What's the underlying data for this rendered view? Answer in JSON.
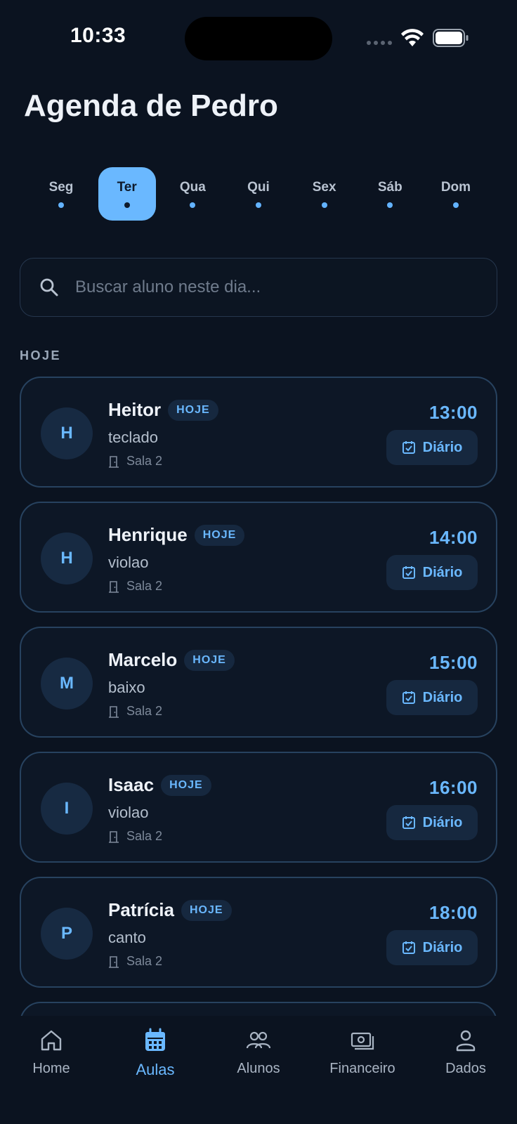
{
  "status_bar": {
    "time": "10:33"
  },
  "page": {
    "title": "Agenda de Pedro"
  },
  "days": [
    {
      "label": "Seg",
      "active": false
    },
    {
      "label": "Ter",
      "active": true
    },
    {
      "label": "Qua",
      "active": false
    },
    {
      "label": "Qui",
      "active": false
    },
    {
      "label": "Sex",
      "active": false
    },
    {
      "label": "Sáb",
      "active": false
    },
    {
      "label": "Dom",
      "active": false
    }
  ],
  "search": {
    "placeholder": "Buscar aluno neste dia...",
    "value": ""
  },
  "section": {
    "label": "HOJE"
  },
  "lessons": [
    {
      "initial": "H",
      "name": "Heitor",
      "badge": "HOJE",
      "instrument": "teclado",
      "room": "Sala 2",
      "time": "13:00",
      "action": "Diário"
    },
    {
      "initial": "H",
      "name": "Henrique",
      "badge": "HOJE",
      "instrument": "violao",
      "room": "Sala 2",
      "time": "14:00",
      "action": "Diário"
    },
    {
      "initial": "M",
      "name": "Marcelo",
      "badge": "HOJE",
      "instrument": "baixo",
      "room": "Sala 2",
      "time": "15:00",
      "action": "Diário"
    },
    {
      "initial": "I",
      "name": "Isaac",
      "badge": "HOJE",
      "instrument": "violao",
      "room": "Sala 2",
      "time": "16:00",
      "action": "Diário"
    },
    {
      "initial": "P",
      "name": "Patrícia",
      "badge": "HOJE",
      "instrument": "canto",
      "room": "Sala 2",
      "time": "18:00",
      "action": "Diário"
    },
    {
      "initial": "",
      "name": "",
      "badge": "",
      "instrument": "",
      "room": "",
      "time": "",
      "action": ""
    }
  ],
  "nav": [
    {
      "label": "Home",
      "icon": "home-icon",
      "active": false
    },
    {
      "label": "Aulas",
      "icon": "calendar-icon",
      "active": true
    },
    {
      "label": "Alunos",
      "icon": "users-icon",
      "active": false
    },
    {
      "label": "Financeiro",
      "icon": "money-icon",
      "active": false
    },
    {
      "label": "Dados",
      "icon": "person-icon",
      "active": false
    }
  ],
  "colors": {
    "accent": "#6ab8ff",
    "background": "#0b1320",
    "card_border": "#27425f"
  }
}
